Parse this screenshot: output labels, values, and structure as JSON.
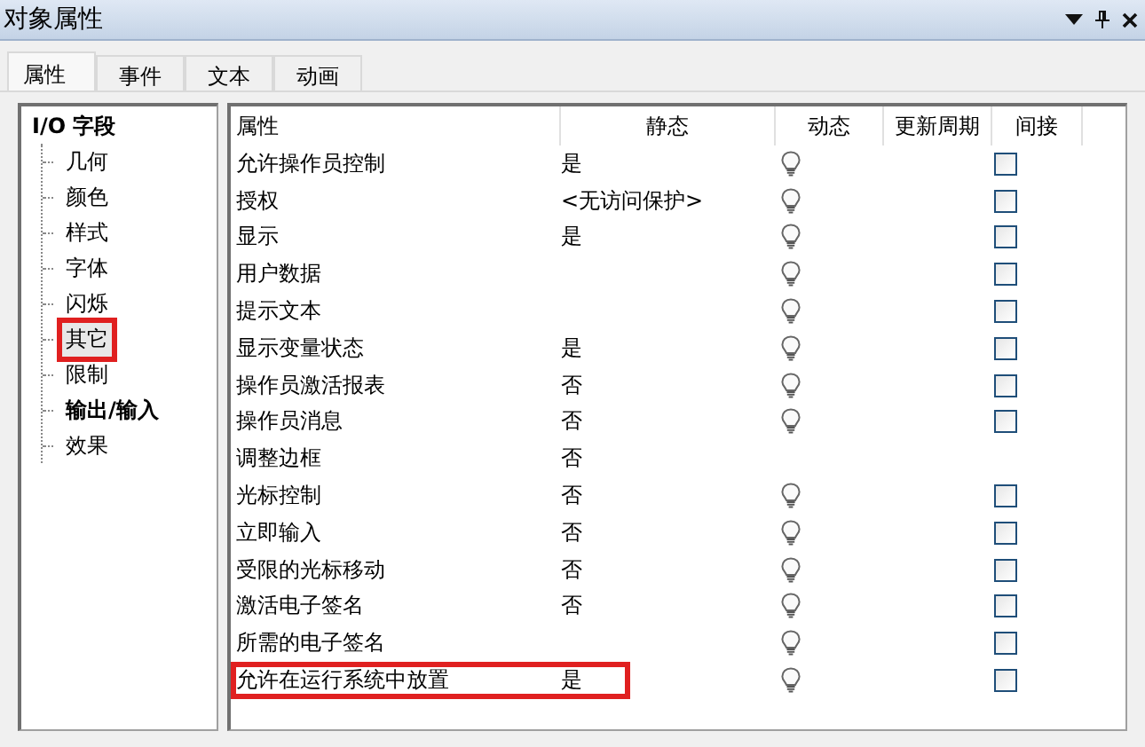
{
  "window": {
    "title": "对象属性"
  },
  "tabs": [
    {
      "label": "属性",
      "selected": true
    },
    {
      "label": "事件",
      "selected": false
    },
    {
      "label": "文本",
      "selected": false
    },
    {
      "label": "动画",
      "selected": false
    }
  ],
  "tree": {
    "label": "I/O 字段",
    "children": [
      {
        "label": "几何",
        "bold": false,
        "selected": false,
        "highlighted": false
      },
      {
        "label": "颜色",
        "bold": false,
        "selected": false,
        "highlighted": false
      },
      {
        "label": "样式",
        "bold": false,
        "selected": false,
        "highlighted": false
      },
      {
        "label": "字体",
        "bold": false,
        "selected": false,
        "highlighted": false
      },
      {
        "label": "闪烁",
        "bold": false,
        "selected": false,
        "highlighted": false
      },
      {
        "label": "其它",
        "bold": false,
        "selected": true,
        "highlighted": true
      },
      {
        "label": "限制",
        "bold": false,
        "selected": false,
        "highlighted": false
      },
      {
        "label": "输出/输入",
        "bold": true,
        "selected": false,
        "highlighted": false
      },
      {
        "label": "效果",
        "bold": false,
        "selected": false,
        "highlighted": false
      }
    ]
  },
  "table": {
    "columns": [
      "属性",
      "静态",
      "动态",
      "更新周期",
      "间接"
    ],
    "rows": [
      {
        "name": "允许操作员控制",
        "static": "是",
        "dynamic": true,
        "indirect": true,
        "checked": false,
        "highlighted": false
      },
      {
        "name": "授权",
        "static": "<无访问保护>",
        "dynamic": true,
        "indirect": true,
        "checked": false,
        "highlighted": false
      },
      {
        "name": "显示",
        "static": "是",
        "dynamic": true,
        "indirect": true,
        "checked": false,
        "highlighted": false
      },
      {
        "name": "用户数据",
        "dynamic": true,
        "indirect": true,
        "checked": false,
        "highlighted": false
      },
      {
        "name": "提示文本",
        "dynamic": true,
        "indirect": true,
        "checked": false,
        "highlighted": false
      },
      {
        "name": "显示变量状态",
        "static": "是",
        "dynamic": true,
        "indirect": true,
        "checked": false,
        "highlighted": false
      },
      {
        "name": "操作员激活报表",
        "static": "否",
        "dynamic": true,
        "indirect": true,
        "checked": false,
        "highlighted": false
      },
      {
        "name": "操作员消息",
        "static": "否",
        "dynamic": true,
        "indirect": true,
        "checked": false,
        "highlighted": false
      },
      {
        "name": "调整边框",
        "static": "否",
        "dynamic": false,
        "indirect": false,
        "highlighted": false
      },
      {
        "name": "光标控制",
        "static": "否",
        "dynamic": true,
        "indirect": true,
        "checked": false,
        "highlighted": false
      },
      {
        "name": "立即输入",
        "static": "否",
        "dynamic": true,
        "indirect": true,
        "checked": false,
        "highlighted": false
      },
      {
        "name": "受限的光标移动",
        "static": "否",
        "dynamic": true,
        "indirect": true,
        "checked": false,
        "highlighted": false
      },
      {
        "name": "激活电子签名",
        "static": "否",
        "dynamic": true,
        "indirect": true,
        "checked": false,
        "highlighted": false
      },
      {
        "name": "所需的电子签名",
        "dynamic": true,
        "indirect": true,
        "checked": false,
        "highlighted": false
      },
      {
        "name": "允许在运行系统中放置",
        "static": "是",
        "dynamic": true,
        "indirect": true,
        "checked": false,
        "highlighted": true
      }
    ]
  }
}
